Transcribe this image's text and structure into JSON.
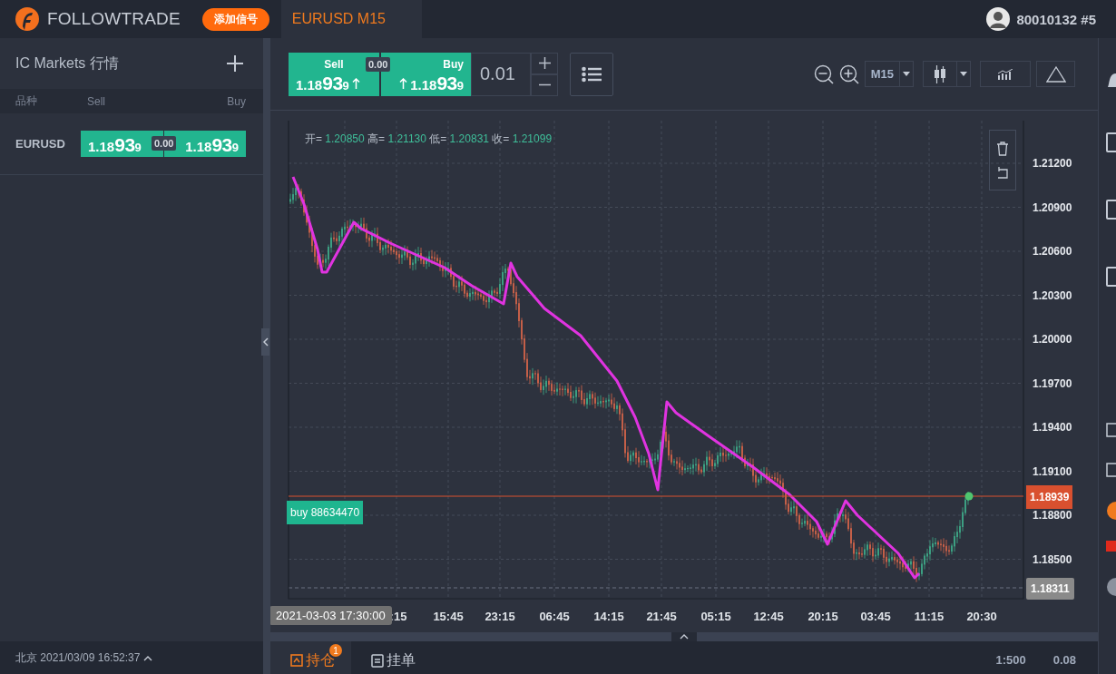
{
  "top_bar": {
    "brand": "FOLLOWTRADE",
    "add_signal_button": "添加信号",
    "tabs": [
      {
        "label": "EURUSD M15",
        "selected": true
      }
    ],
    "account": "80010132 #5"
  },
  "sidebar": {
    "title": "IC Markets 行情",
    "columns": [
      "品种",
      "Sell",
      "Buy"
    ],
    "rows": [
      {
        "symbol": "EURUSD",
        "sell": {
          "prefix": "1.18",
          "pips": "93",
          "point": "9"
        },
        "spread": "0.00",
        "buy": {
          "prefix": "1.18",
          "pips": "93",
          "point": "9"
        }
      }
    ],
    "footer": "北京 2021/03/09 16:52:37"
  },
  "trade_bar": {
    "sell": {
      "label": "Sell",
      "prefix": "1.18",
      "pips": "93",
      "point": "9"
    },
    "spread": "0.00",
    "buy": {
      "label": "Buy",
      "prefix": "1.18",
      "pips": "93",
      "point": "9"
    },
    "volume": "0.01",
    "timeframe": "M15"
  },
  "chart": {
    "ohlc": [
      {
        "label": "开=",
        "value": "1.20850"
      },
      {
        "label": "高=",
        "value": "1.21130"
      },
      {
        "label": "低=",
        "value": "1.20831"
      },
      {
        "label": "收=",
        "value": "1.21099"
      }
    ],
    "y_labels": [
      "1.21200",
      "1.20900",
      "1.20600",
      "1.20300",
      "1.20000",
      "1.19700",
      "1.19400",
      "1.19100",
      "1.18800",
      "1.18500"
    ],
    "current_price": "1.18939",
    "low_marker": "1.18311",
    "order_label": "buy 88634470",
    "crosshair_time": "2021-03-03 17:30:00",
    "x_labels": [
      ":15",
      "15:45",
      "23:15",
      "06:45",
      "14:15",
      "21:45",
      "05:15",
      "12:45",
      "20:15",
      "03:45",
      "11:15",
      "20:30"
    ]
  },
  "bottom_bar": {
    "tabs": [
      {
        "label": "持仓",
        "selected": true,
        "badge": "1"
      },
      {
        "label": "挂单",
        "selected": false
      }
    ],
    "stats": [
      "1:500",
      "0.08"
    ]
  }
}
